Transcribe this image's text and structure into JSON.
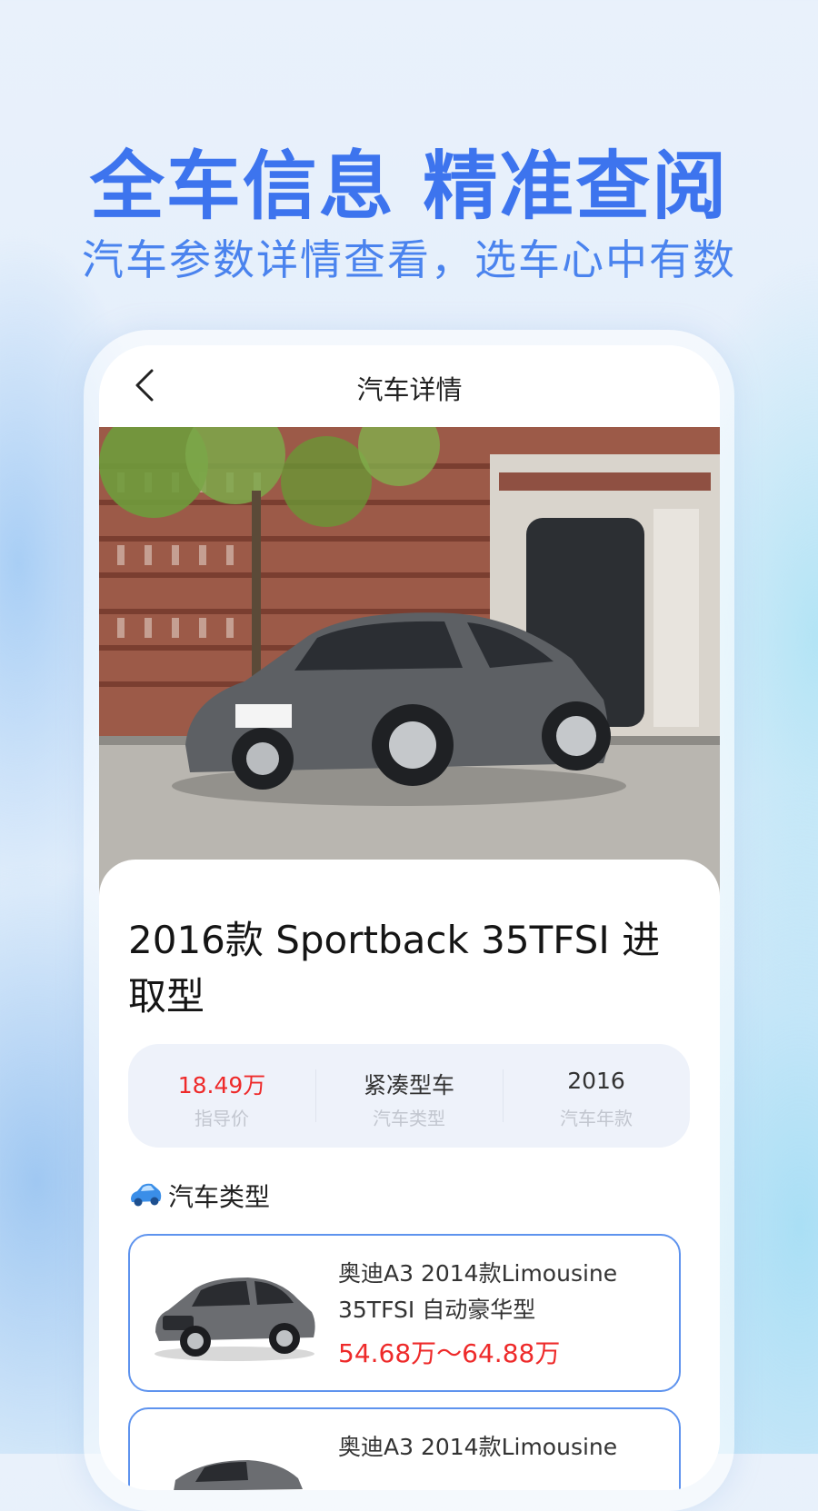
{
  "promo": {
    "headline": "全车信息 精准查阅",
    "subline": "汽车参数详情查看，选车心中有数",
    "headline_color": "#3d74ee"
  },
  "nav": {
    "back_icon": "chevron-left-icon",
    "title": "汽车详情"
  },
  "car": {
    "title": "2016款 Sportback 35TFSI 进取型",
    "stats": [
      {
        "value": "18.49万",
        "label": "指导价",
        "value_color": "#ee2a2a"
      },
      {
        "value": "紧凑型车",
        "label": "汽车类型"
      },
      {
        "value": "2016",
        "label": "汽车年款"
      }
    ]
  },
  "section": {
    "icon": "car-icon",
    "title": "汽车类型"
  },
  "related": [
    {
      "name": "奥迪A3 2014款Limousine 35TFSI 自动豪华型",
      "price": "54.68万～64.88万"
    },
    {
      "name": "奥迪A3 2014款Limousine",
      "price": ""
    }
  ],
  "colors": {
    "accent": "#3d74ee",
    "price_red": "#ee2a2a",
    "card_border": "#5e93ee"
  }
}
